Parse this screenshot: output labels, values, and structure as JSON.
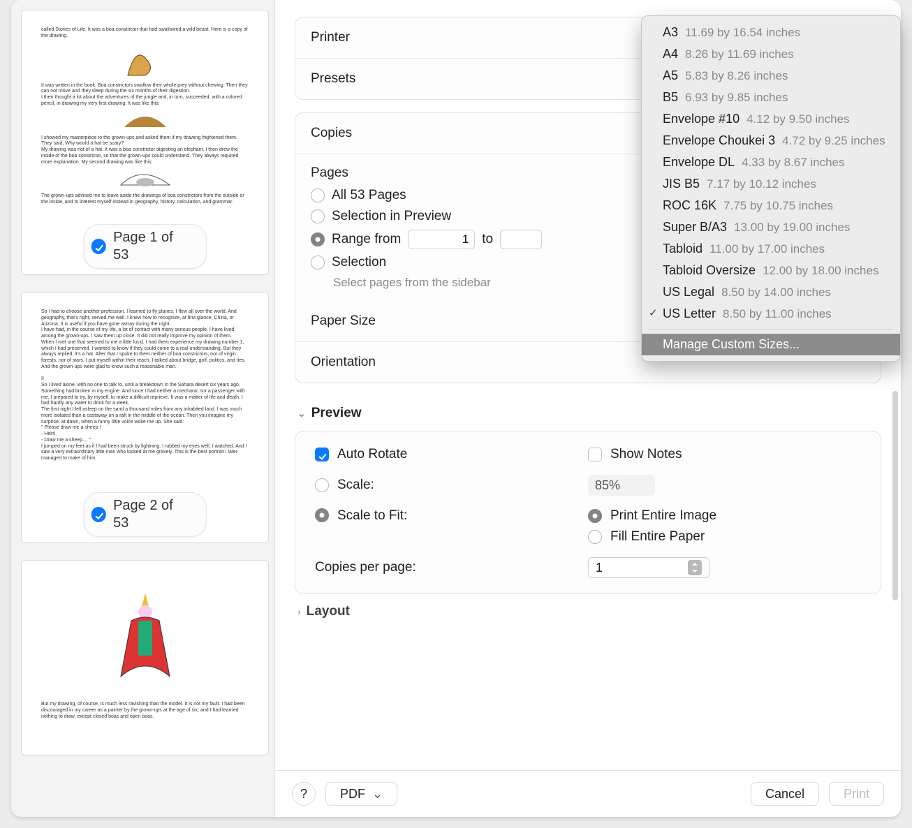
{
  "sidebar": {
    "pages": [
      {
        "label": "Page 1 of 53"
      },
      {
        "label": "Page 2 of 53"
      }
    ]
  },
  "printer_label": "Printer",
  "presets_label": "Presets",
  "copies_label": "Copies",
  "pages": {
    "title": "Pages",
    "all": "All 53 Pages",
    "selection_preview": "Selection in Preview",
    "range_from": "Range from",
    "range_from_value": "1",
    "to_label": "to",
    "selection": "Selection",
    "selection_sub": "Select pages from the sidebar"
  },
  "paper_size_label": "Paper Size",
  "orientation_label": "Orientation",
  "preview": {
    "title": "Preview",
    "auto_rotate": "Auto Rotate",
    "show_notes": "Show Notes",
    "scale_label": "Scale:",
    "scale_value": "85%",
    "scale_to_fit": "Scale to Fit:",
    "entire_image": "Print Entire Image",
    "fill_paper": "Fill Entire Paper",
    "copies_per_page": "Copies per page:",
    "copies_per_page_value": "1"
  },
  "layout_title": "Layout",
  "footer": {
    "help": "?",
    "pdf": "PDF",
    "cancel": "Cancel",
    "print": "Print"
  },
  "paper_sizes": [
    {
      "name": "A3",
      "dim": "11.69 by 16.54 inches"
    },
    {
      "name": "A4",
      "dim": "8.26 by 11.69 inches"
    },
    {
      "name": "A5",
      "dim": "5.83 by 8.26 inches"
    },
    {
      "name": "B5",
      "dim": "6.93 by 9.85 inches"
    },
    {
      "name": "Envelope #10",
      "dim": "4.12 by 9.50 inches"
    },
    {
      "name": "Envelope Choukei 3",
      "dim": "4.72 by 9.25 inches"
    },
    {
      "name": "Envelope DL",
      "dim": "4.33 by 8.67 inches"
    },
    {
      "name": "JIS B5",
      "dim": "7.17 by 10.12 inches"
    },
    {
      "name": "ROC 16K",
      "dim": "7.75 by 10.75 inches"
    },
    {
      "name": "Super B/A3",
      "dim": "13.00 by 19.00 inches"
    },
    {
      "name": "Tabloid",
      "dim": "11.00 by 17.00 inches"
    },
    {
      "name": "Tabloid Oversize",
      "dim": "12.00 by 18.00 inches"
    },
    {
      "name": "US Legal",
      "dim": "8.50 by 14.00 inches"
    },
    {
      "name": "US Letter",
      "dim": "8.50 by 11.00 inches",
      "checked": true
    }
  ],
  "manage_custom": "Manage Custom Sizes..."
}
